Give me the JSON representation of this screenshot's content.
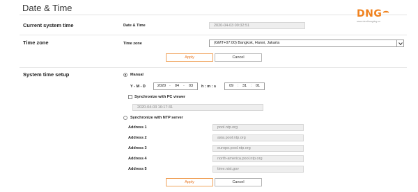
{
  "page": {
    "title": "Date & Time"
  },
  "logo": {
    "text": "DNG",
    "tagline": "www.vienthongdng.vn"
  },
  "current_time": {
    "section_label": "Current system time",
    "field_label": "Date & Time",
    "value": "2020-04-03 09:32:51"
  },
  "timezone": {
    "section_label": "Time zone",
    "field_label": "Time zone",
    "selected": "(GMT+07:00) Bangkok, Hanoi, Jakarta"
  },
  "buttons": {
    "apply": "Apply",
    "cancel": "Cancel"
  },
  "setup": {
    "section_label": "System time setup",
    "manual_label": "Manual",
    "manual_selected": true,
    "ymd_label": "Y - M - D",
    "year": "2020",
    "month": "04",
    "day": "03",
    "hms_label": "h : m : s",
    "hour": "09",
    "minute": "31",
    "second": "01",
    "sync_pc_label": "Synchronize with PC viewer",
    "sync_pc_checked": false,
    "pc_time": "2020-04-03 16:17:31",
    "ntp_label": "Synchronize with NTP server",
    "ntp_selected": false,
    "addresses": [
      {
        "label": "Address 1",
        "value": "pool.ntp.org"
      },
      {
        "label": "Address 2",
        "value": "asia.pool.ntp.org"
      },
      {
        "label": "Address 3",
        "value": "europe.pool.ntp.org"
      },
      {
        "label": "Address 4",
        "value": "north-america.pool.ntp.org"
      },
      {
        "label": "Address 5",
        "value": "time.nist.gov"
      }
    ]
  },
  "colors": {
    "accent": "#f0821e",
    "apply_border": "#f0a25a"
  }
}
